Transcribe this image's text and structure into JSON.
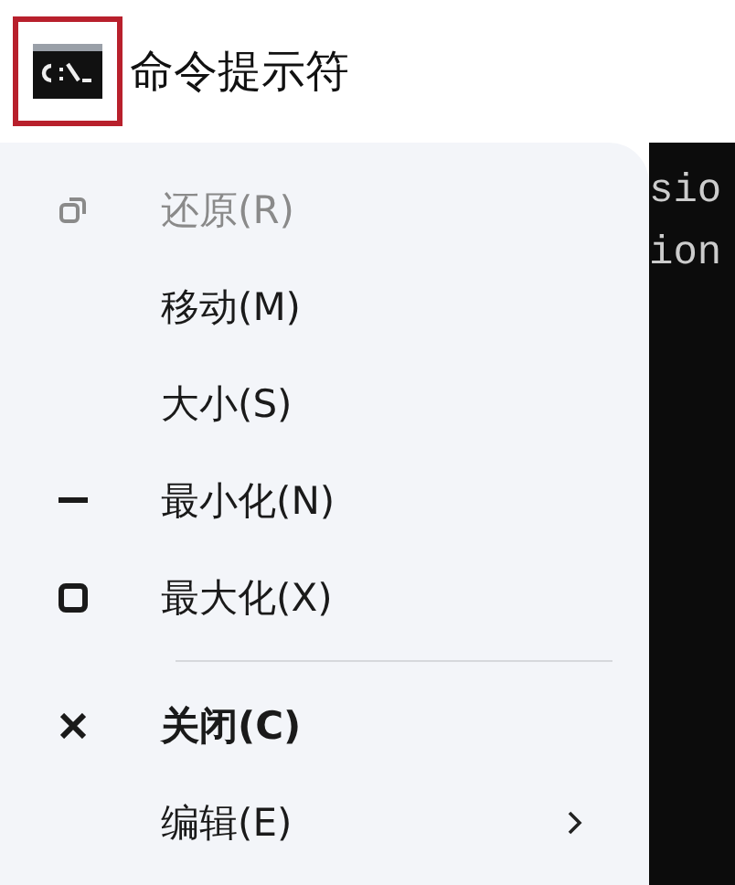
{
  "window": {
    "title": "命令提示符",
    "icon_highlighted": true
  },
  "console": {
    "lines": [
      "sio",
      "ion"
    ]
  },
  "menu": {
    "items": [
      {
        "kind": "restore",
        "label": "还原(R)",
        "disabled": true,
        "default": false
      },
      {
        "kind": "plain",
        "label": "移动(M)",
        "disabled": false,
        "default": false
      },
      {
        "kind": "plain",
        "label": "大小(S)",
        "disabled": false,
        "default": false
      },
      {
        "kind": "minimize",
        "label": "最小化(N)",
        "disabled": false,
        "default": false
      },
      {
        "kind": "maximize",
        "label": "最大化(X)",
        "disabled": false,
        "default": false
      },
      {
        "kind": "separator"
      },
      {
        "kind": "close",
        "label": "关闭(C)",
        "disabled": false,
        "default": true
      },
      {
        "kind": "submenu",
        "label": "编辑(E)",
        "disabled": false,
        "default": false
      }
    ]
  }
}
